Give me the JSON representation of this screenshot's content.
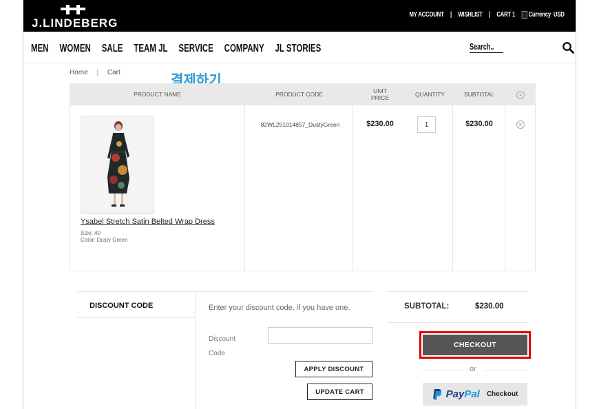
{
  "brand": {
    "logo_text": "J.LINDEBERG"
  },
  "top_links": {
    "my_account": "MY ACCOUNT",
    "wishlist": "WISHLIST",
    "cart": "CART 1",
    "currency_alt": "Currency",
    "currency_code": "USD",
    "separator": "|"
  },
  "nav": {
    "items": [
      "MEN",
      "WOMEN",
      "SALE",
      "TEAM JL",
      "SERVICE",
      "COMPANY",
      "JL STORIES"
    ],
    "search_placeholder": "Search.."
  },
  "breadcrumb": {
    "home": "Home",
    "separator": "|",
    "current": "Cart"
  },
  "annotation": {
    "text": "결제하기",
    "color": "#2b9bd8"
  },
  "cart_table": {
    "headers": {
      "product_name": "PRODUCT NAME",
      "product_code": "PRODUCT CODE",
      "unit_price_line1": "UNIT",
      "unit_price_line2": "PRICE",
      "quantity": "QUANTITY",
      "subtotal": "SUBTOTAL"
    },
    "items": [
      {
        "name": "Ysabel Stretch Satin Belted Wrap Dress",
        "size": "Size: 40",
        "color": "Color: Dusty Green",
        "code": "82WL251014857_DustyGreen",
        "unit_price": "$230.00",
        "quantity": "1",
        "subtotal": "$230.00"
      }
    ]
  },
  "discount": {
    "tab_label": "DISCOUNT CODE",
    "hint": "Enter your discount code, if you have one.",
    "label_line1": "Discount",
    "label_line2": "Code",
    "input_value": "",
    "apply_label": "APPLY DISCOUNT",
    "update_label": "UPDATE CART"
  },
  "summary": {
    "subtotal_label": "SUBTOTAL:",
    "subtotal_value": "$230.00",
    "checkout_label": "CHECKOUT",
    "or_text": "or",
    "paypal_pay": "Pay",
    "paypal_pal": "Pal",
    "paypal_checkout": "Checkout"
  },
  "colors": {
    "topbar": "#000000",
    "checkout_button": "#555555",
    "highlight_border": "#e00000",
    "paypal_dark": "#253b80",
    "paypal_light": "#179bd7"
  }
}
